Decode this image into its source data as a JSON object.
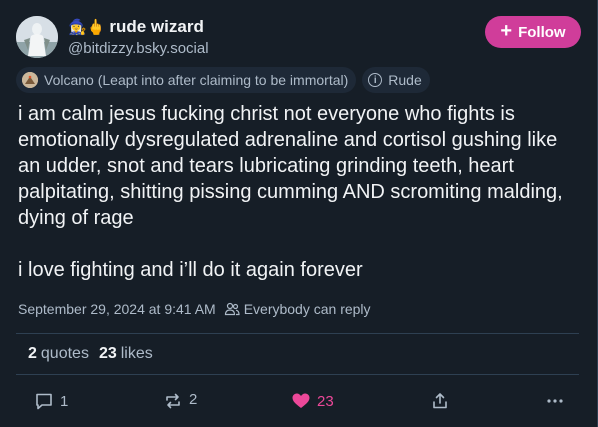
{
  "author": {
    "display_name": "rude wizard",
    "name_emoji": "🧙‍♀️🖕",
    "handle": "@bitdizzy.bsky.social",
    "avatar": "avatar-statue-image"
  },
  "follow_button": {
    "label": "Follow",
    "icon": "plus-icon"
  },
  "labels": [
    {
      "text": "Volcano (Leapt into after claiming to be immortal)",
      "icon": "volcano-icon"
    },
    {
      "text": "Rude",
      "icon": "info-icon"
    }
  ],
  "post": {
    "text": "i am calm jesus fucking christ not everyone who fights is emotionally dysregulated adrenaline and cortisol gushing like an udder, snot and tears lubricating grinding teeth, heart palpitating, shitting pissing cumming AND scromiting malding, dying of rage\n\ni love fighting and i’ll do it again forever"
  },
  "meta": {
    "timestamp": "September 29, 2024 at 9:41 AM",
    "reply_setting": "Everybody can reply"
  },
  "stats": {
    "quotes_count": "2",
    "quotes_label": "quotes",
    "likes_count": "23",
    "likes_label": "likes"
  },
  "actions": {
    "reply_count": "1",
    "repost_count": "2",
    "like_count": "23"
  },
  "colors": {
    "accent": "#d03d9a",
    "like": "#ec4899",
    "background": "#161e27"
  }
}
